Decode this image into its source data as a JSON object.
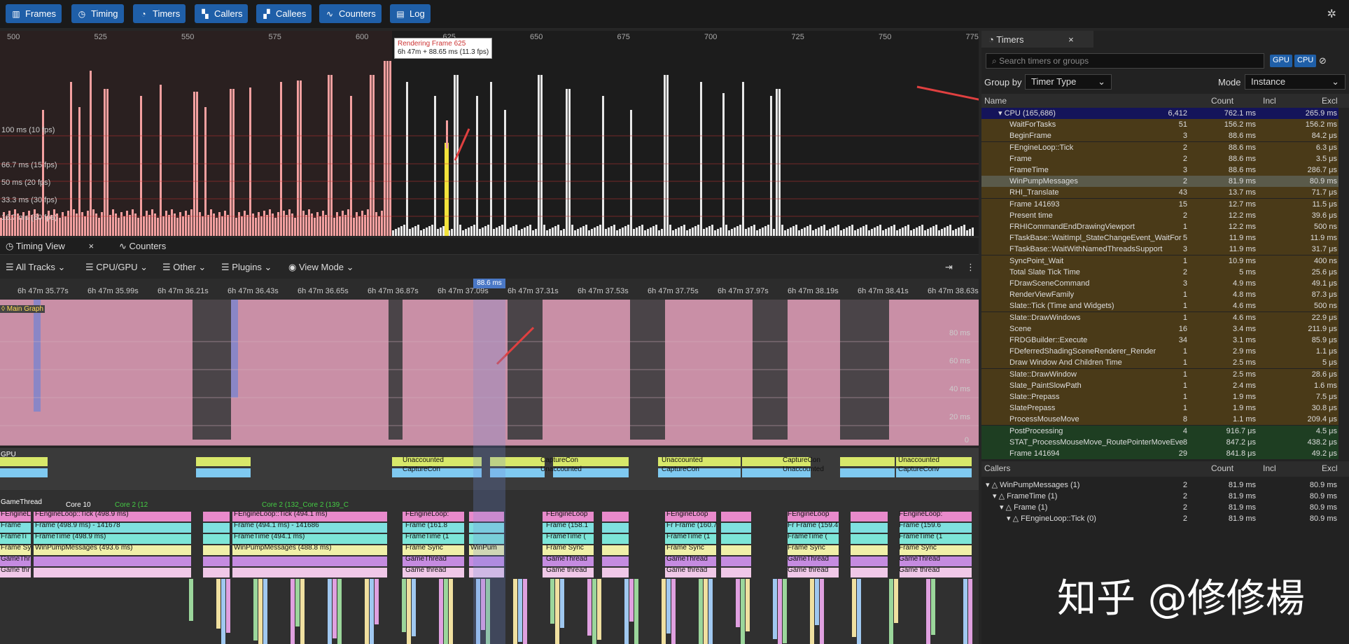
{
  "toolbar": {
    "buttons": [
      {
        "label": "Frames",
        "icon": "bar-chart-icon"
      },
      {
        "label": "Timing",
        "icon": "clock-icon"
      },
      {
        "label": "Timers",
        "icon": "stopwatch-icon"
      },
      {
        "label": "Callers",
        "icon": "callers-icon"
      },
      {
        "label": "Callees",
        "icon": "callees-icon"
      },
      {
        "label": "Counters",
        "icon": "pulse-icon"
      },
      {
        "label": "Log",
        "icon": "log-icon"
      }
    ]
  },
  "frames": {
    "ticks": [
      "500",
      "525",
      "550",
      "575",
      "600",
      "625",
      "650",
      "675",
      "700",
      "725",
      "750",
      "775"
    ],
    "labels": [
      "100 ms (10 fps)",
      "66.7 ms (15 fps)",
      "50 ms (20 fps)",
      "33.3 ms (30 fps)",
      "16.7 ms (60 fps)"
    ],
    "tooltip_title": "Rendering Frame 625",
    "tooltip_detail": "6h 47m + 88.65 ms (11.3 fps)"
  },
  "timing_tabs": {
    "timing_view": "Timing View",
    "counters": "Counters"
  },
  "filterbar": {
    "all_tracks": "All Tracks",
    "cpu_gpu": "CPU/GPU",
    "other": "Other",
    "plugins": "Plugins",
    "view_mode": "View Mode"
  },
  "ruler": {
    "selection": "88.6 ms",
    "ticks": [
      "6h 47m 35.77s",
      "6h 47m 35.99s",
      "6h 47m 36.21s",
      "6h 47m 36.43s",
      "6h 47m 36.65s",
      "6h 47m 36.87s",
      "6h 47m 37.09s",
      "6h 47m 37.31s",
      "6h 47m 37.53s",
      "6h 47m 37.75s",
      "6h 47m 37.97s",
      "6h 47m 38.19s",
      "6h 47m 38.41s",
      "6h 47m 38.63s"
    ]
  },
  "tracks": {
    "main_graph": "Main Graph",
    "ms_labels": [
      "80 ms",
      "60 ms",
      "40 ms",
      "20 ms"
    ],
    "zero": "0",
    "gpu": "GPU",
    "gamethread": "GameThread",
    "core10": "Core 10",
    "core2": "Core 2 (12",
    "core2b": "Core 2 (132_Core 2 (139_C",
    "texts": [
      "Unaccounted",
      "CaptureCon",
      "Unaccounted",
      "CaptureCon",
      "Unaccounted",
      "CaptureCon",
      "Unaccounted",
      "CaptureCon",
      "Unaccounted",
      "CaptureConv",
      "FEngineL",
      "FEngineLoop::Tick (498.9 ms)",
      "FEngineLoop::Tick (494.1 ms)",
      "FEngineLoop:",
      "FEngineLoop",
      "FEngineLoop",
      "FEngineLoop",
      "FEngineLoop:",
      "Frame",
      "Frame (498.9 ms) - 141678",
      "Frame (494.1 ms) - 141686",
      "Frame (161.8",
      "Frame (158.1",
      "Fr Frame (160.7",
      "Fr Frame (159.4",
      "Frame (159.6",
      "FrameTi",
      "FrameTime (498.9 ms)",
      "FrameTime (494.1 ms)",
      "FrameTime (1",
      "FrameTime (",
      "FrameTime (1",
      "FrameTime (",
      "FrameTime (1",
      "Frame Sy",
      "WinPumpMessages (493.6 ms)",
      "WinPumpMessages (488.8 ms)",
      "Frame Sync",
      "WinPum",
      "Frame Sync",
      "Frame Sync",
      "Frame Sync",
      "Frame Sync",
      "GameThr",
      "GameThread",
      "GameThread",
      "GameThread",
      "GameThread",
      "GameThread",
      "Game thr",
      "Game thread",
      "Game thread",
      "Game thread",
      "Game thread",
      "Game thread"
    ]
  },
  "timers": {
    "tab": "Timers",
    "search_placeholder": "Search timers or groups",
    "gpu": "GPU",
    "cpu": "CPU",
    "group_by_label": "Group by",
    "group_by_value": "Timer Type",
    "mode_label": "Mode",
    "mode_value": "Instance",
    "headers": {
      "name": "Name",
      "count": "Count",
      "incl": "Incl",
      "excl": "Excl"
    },
    "rows": [
      {
        "name": "CPU (165,686)",
        "count": "6,412",
        "incl": "762.1 ms",
        "excl": "265.9 ms",
        "kind": "group"
      },
      {
        "name": "WaitForTasks",
        "count": "51",
        "incl": "156.2 ms",
        "excl": "156.2 ms"
      },
      {
        "name": "BeginFrame",
        "count": "3",
        "incl": "88.6 ms",
        "excl": "84.2 μs"
      },
      {
        "name": "FEngineLoop::Tick",
        "count": "2",
        "incl": "88.6 ms",
        "excl": "6.3 μs"
      },
      {
        "name": "Frame",
        "count": "2",
        "incl": "88.6 ms",
        "excl": "3.5 μs"
      },
      {
        "name": "FrameTime",
        "count": "3",
        "incl": "88.6 ms",
        "excl": "286.7 μs"
      },
      {
        "name": "WinPumpMessages",
        "count": "2",
        "incl": "81.9 ms",
        "excl": "80.9 ms",
        "kind": "sel"
      },
      {
        "name": "RHI_Translate",
        "count": "43",
        "incl": "13.7 ms",
        "excl": "71.7 μs"
      },
      {
        "name": "Frame 141693",
        "count": "15",
        "incl": "12.7 ms",
        "excl": "11.5 μs"
      },
      {
        "name": "Present time",
        "count": "2",
        "incl": "12.2 ms",
        "excl": "39.6 μs"
      },
      {
        "name": "FRHICommandEndDrawingViewport",
        "count": "1",
        "incl": "12.2 ms",
        "excl": "500 ns"
      },
      {
        "name": "FTaskBase::WaitImpl_StateChangeEvent_WaitFor",
        "count": "5",
        "incl": "11.9 ms",
        "excl": "11.9 ms"
      },
      {
        "name": "FTaskBase::WaitWithNamedThreadsSupport",
        "count": "3",
        "incl": "11.9 ms",
        "excl": "31.7 μs"
      },
      {
        "name": "SyncPoint_Wait",
        "count": "1",
        "incl": "10.9 ms",
        "excl": "400 ns"
      },
      {
        "name": "Total Slate Tick Time",
        "count": "2",
        "incl": "5 ms",
        "excl": "25.6 μs"
      },
      {
        "name": "FDrawSceneCommand",
        "count": "3",
        "incl": "4.9 ms",
        "excl": "49.1 μs"
      },
      {
        "name": "RenderViewFamily",
        "count": "1",
        "incl": "4.8 ms",
        "excl": "87.3 μs"
      },
      {
        "name": "Slate::Tick (Time and Widgets)",
        "count": "1",
        "incl": "4.6 ms",
        "excl": "500 ns"
      },
      {
        "name": "Slate::DrawWindows",
        "count": "1",
        "incl": "4.6 ms",
        "excl": "22.9 μs"
      },
      {
        "name": "Scene",
        "count": "16",
        "incl": "3.4 ms",
        "excl": "211.9 μs"
      },
      {
        "name": "FRDGBuilder::Execute",
        "count": "34",
        "incl": "3.1 ms",
        "excl": "85.9 μs"
      },
      {
        "name": "FDeferredShadingSceneRenderer_Render",
        "count": "1",
        "incl": "2.9 ms",
        "excl": "1.1 μs"
      },
      {
        "name": "Draw Window And Children Time",
        "count": "1",
        "incl": "2.5 ms",
        "excl": "5 μs"
      },
      {
        "name": "Slate::DrawWindow",
        "count": "1",
        "incl": "2.5 ms",
        "excl": "28.6 μs"
      },
      {
        "name": "Slate_PaintSlowPath",
        "count": "1",
        "incl": "2.4 ms",
        "excl": "1.6 ms"
      },
      {
        "name": "Slate::Prepass",
        "count": "1",
        "incl": "1.9 ms",
        "excl": "7.5 μs"
      },
      {
        "name": "SlatePrepass",
        "count": "1",
        "incl": "1.9 ms",
        "excl": "30.8 μs"
      },
      {
        "name": "ProcessMouseMove",
        "count": "8",
        "incl": "1.1 ms",
        "excl": "209.4 μs"
      },
      {
        "name": "PostProcessing",
        "count": "4",
        "incl": "916.7 μs",
        "excl": "4.5 μs",
        "kind": "green"
      },
      {
        "name": "STAT_ProcessMouseMove_RoutePointerMoveEve",
        "count": "8",
        "incl": "847.2 μs",
        "excl": "438.2 μs",
        "kind": "green"
      },
      {
        "name": "Frame 141694",
        "count": "29",
        "incl": "841.8 μs",
        "excl": "49.2 μs",
        "kind": "green"
      }
    ]
  },
  "callers": {
    "title": "Callers",
    "headers": {
      "count": "Count",
      "incl": "Incl",
      "excl": "Excl"
    },
    "rows": [
      {
        "name": "WinPumpMessages (1)",
        "count": "2",
        "incl": "81.9 ms",
        "excl": "80.9 ms",
        "indent": 0
      },
      {
        "name": "FrameTime (1)",
        "count": "2",
        "incl": "81.9 ms",
        "excl": "80.9 ms",
        "indent": 1
      },
      {
        "name": "Frame (1)",
        "count": "2",
        "incl": "81.9 ms",
        "excl": "80.9 ms",
        "indent": 2
      },
      {
        "name": "FEngineLoop::Tick (0)",
        "count": "2",
        "incl": "81.9 ms",
        "excl": "80.9 ms",
        "indent": 3
      }
    ]
  },
  "watermark": "知乎 @修修楊",
  "colors": {
    "accent": "#1f5fa8",
    "frame_bar": "#f4a0a0",
    "highlight": "#f2e23a",
    "graph": "#c98fa6",
    "timer_row": "#4a3a18",
    "green_row": "#1e3e22"
  }
}
